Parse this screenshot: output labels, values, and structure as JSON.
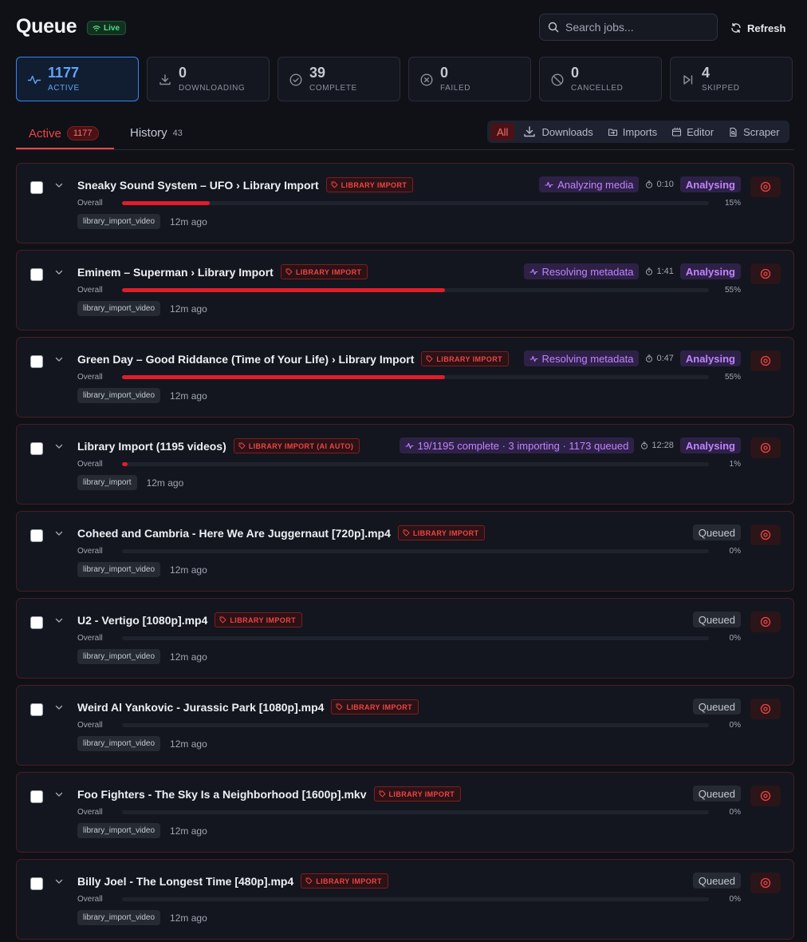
{
  "header": {
    "title": "Queue",
    "live_label": "Live",
    "search_placeholder": "Search jobs...",
    "refresh_label": "Refresh"
  },
  "stats": [
    {
      "value": "1177",
      "label": "ACTIVE",
      "icon": "activity-icon",
      "selected": true
    },
    {
      "value": "0",
      "label": "DOWNLOADING",
      "icon": "download-icon",
      "selected": false
    },
    {
      "value": "39",
      "label": "COMPLETE",
      "icon": "check-circle-icon",
      "selected": false
    },
    {
      "value": "0",
      "label": "FAILED",
      "icon": "x-circle-icon",
      "selected": false
    },
    {
      "value": "0",
      "label": "CANCELLED",
      "icon": "ban-icon",
      "selected": false
    },
    {
      "value": "4",
      "label": "SKIPPED",
      "icon": "skip-forward-icon",
      "selected": false
    }
  ],
  "tabs": {
    "active_label": "Active",
    "active_count": "1177",
    "history_label": "History",
    "history_count": "43"
  },
  "filters": [
    {
      "label": "All",
      "icon": "",
      "selected": true
    },
    {
      "label": "Downloads",
      "icon": "download-icon",
      "selected": false
    },
    {
      "label": "Imports",
      "icon": "folder-import-icon",
      "selected": false
    },
    {
      "label": "Editor",
      "icon": "film-editor-icon",
      "selected": false
    },
    {
      "label": "Scraper",
      "icon": "file-search-icon",
      "selected": false
    }
  ],
  "overall_label": "Overall",
  "jobs": [
    {
      "title": "Sneaky Sound System – UFO › Library Import",
      "tag": "LIBRARY IMPORT",
      "phase": "Analyzing media",
      "timer": "0:10",
      "status": "Analysing",
      "progress": 15,
      "progress_label": "15%",
      "type": "library_import_video",
      "ago": "12m ago"
    },
    {
      "title": "Eminem – Superman › Library Import",
      "tag": "LIBRARY IMPORT",
      "phase": "Resolving metadata",
      "timer": "1:41",
      "status": "Analysing",
      "progress": 55,
      "progress_label": "55%",
      "type": "library_import_video",
      "ago": "12m ago"
    },
    {
      "title": "Green Day – Good Riddance (Time of Your Life) › Library Import",
      "tag": "LIBRARY IMPORT",
      "phase": "Resolving metadata",
      "timer": "0:47",
      "status": "Analysing",
      "progress": 55,
      "progress_label": "55%",
      "type": "library_import_video",
      "ago": "12m ago"
    },
    {
      "title": "Library Import (1195 videos)",
      "tag": "LIBRARY IMPORT (AI AUTO)",
      "phase": "19/1195 complete · 3 importing · 1173 queued",
      "timer": "12:28",
      "status": "Analysing",
      "progress": 1,
      "progress_label": "1%",
      "type": "library_import",
      "ago": "12m ago"
    },
    {
      "title": "Coheed and Cambria - Here We Are Juggernaut [720p].mp4",
      "tag": "LIBRARY IMPORT",
      "phase": "",
      "timer": "",
      "status": "Queued",
      "progress": 0,
      "progress_label": "0%",
      "type": "library_import_video",
      "ago": "12m ago"
    },
    {
      "title": "U2 - Vertigo [1080p].mp4",
      "tag": "LIBRARY IMPORT",
      "phase": "",
      "timer": "",
      "status": "Queued",
      "progress": 0,
      "progress_label": "0%",
      "type": "library_import_video",
      "ago": "12m ago"
    },
    {
      "title": "Weird Al Yankovic - Jurassic Park [1080p].mp4",
      "tag": "LIBRARY IMPORT",
      "phase": "",
      "timer": "",
      "status": "Queued",
      "progress": 0,
      "progress_label": "0%",
      "type": "library_import_video",
      "ago": "12m ago"
    },
    {
      "title": "Foo Fighters - The Sky Is a Neighborhood [1600p].mkv",
      "tag": "LIBRARY IMPORT",
      "phase": "",
      "timer": "",
      "status": "Queued",
      "progress": 0,
      "progress_label": "0%",
      "type": "library_import_video",
      "ago": "12m ago"
    },
    {
      "title": "Billy Joel - The Longest Time [480p].mp4",
      "tag": "LIBRARY IMPORT",
      "phase": "",
      "timer": "",
      "status": "Queued",
      "progress": 0,
      "progress_label": "0%",
      "type": "library_import_video",
      "ago": "12m ago"
    }
  ]
}
